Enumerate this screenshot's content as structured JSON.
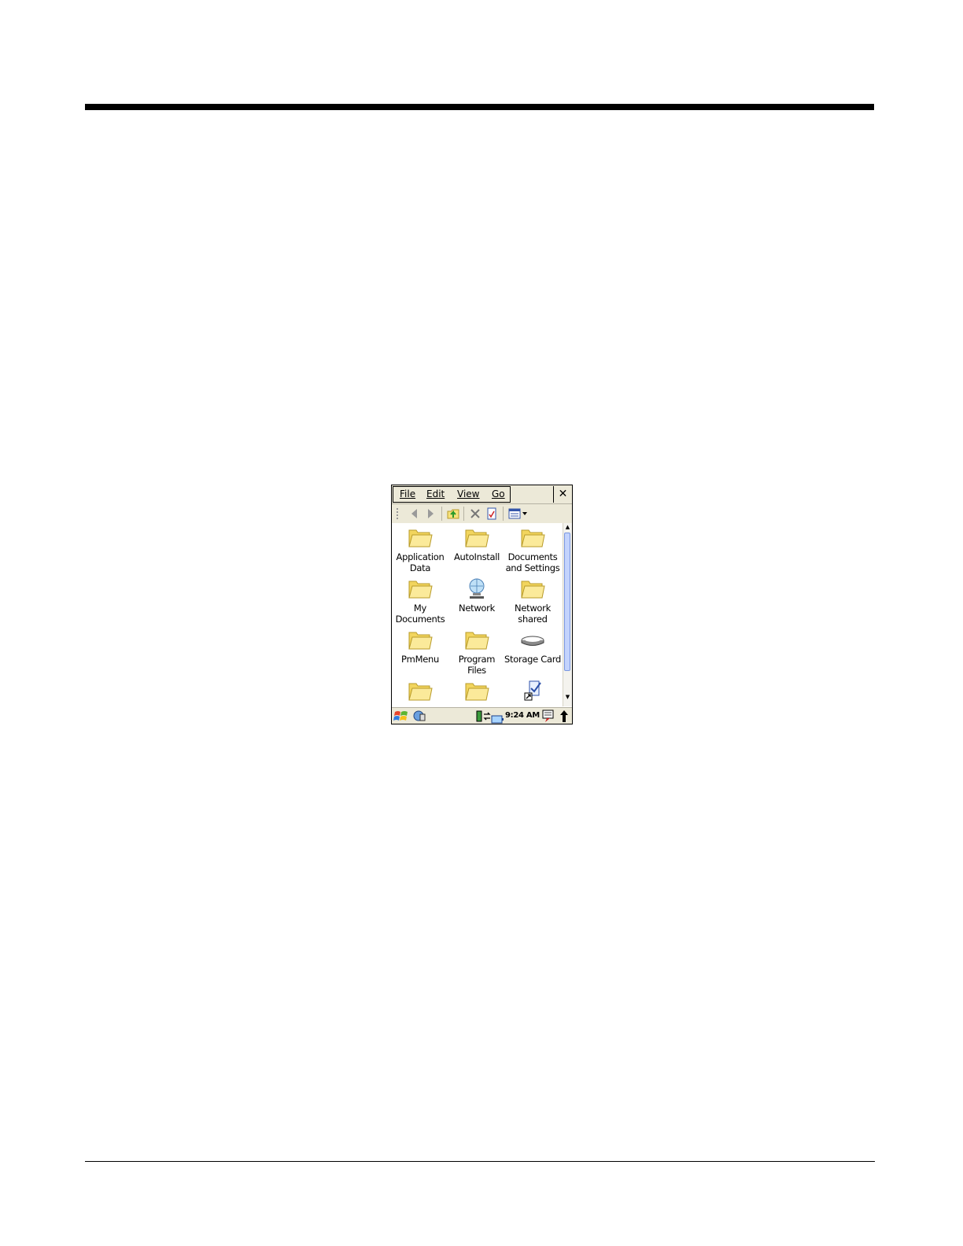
{
  "menu": {
    "file": "File",
    "edit": "Edit",
    "view": "View",
    "go": "Go",
    "close": "✕"
  },
  "toolbar": {
    "icons": [
      "back-icon",
      "forward-icon",
      "up-folder-icon",
      "delete-icon",
      "properties-icon",
      "view-mode-icon"
    ]
  },
  "items": [
    {
      "label": "Application Data",
      "icon": "folder-icon"
    },
    {
      "label": "AutoInstall",
      "icon": "folder-icon"
    },
    {
      "label": "Documents and Settings",
      "icon": "folder-icon"
    },
    {
      "label": "My Documents",
      "icon": "folder-icon"
    },
    {
      "label": "Network",
      "icon": "network-icon"
    },
    {
      "label": "Network shared",
      "icon": "folder-icon"
    },
    {
      "label": "PmMenu",
      "icon": "folder-icon"
    },
    {
      "label": "Program Files",
      "icon": "folder-icon"
    },
    {
      "label": "Storage Card",
      "icon": "storage-card-icon"
    },
    {
      "label": "",
      "icon": "folder-icon"
    },
    {
      "label": "",
      "icon": "folder-icon"
    },
    {
      "label": "",
      "icon": "shortcut-icon"
    }
  ],
  "taskbar": {
    "time": "9:24 AM"
  },
  "colors": {
    "chrome": "#ece9d8",
    "folder": "#f7e27a",
    "scroll_thumb": "#c3d3fd"
  }
}
